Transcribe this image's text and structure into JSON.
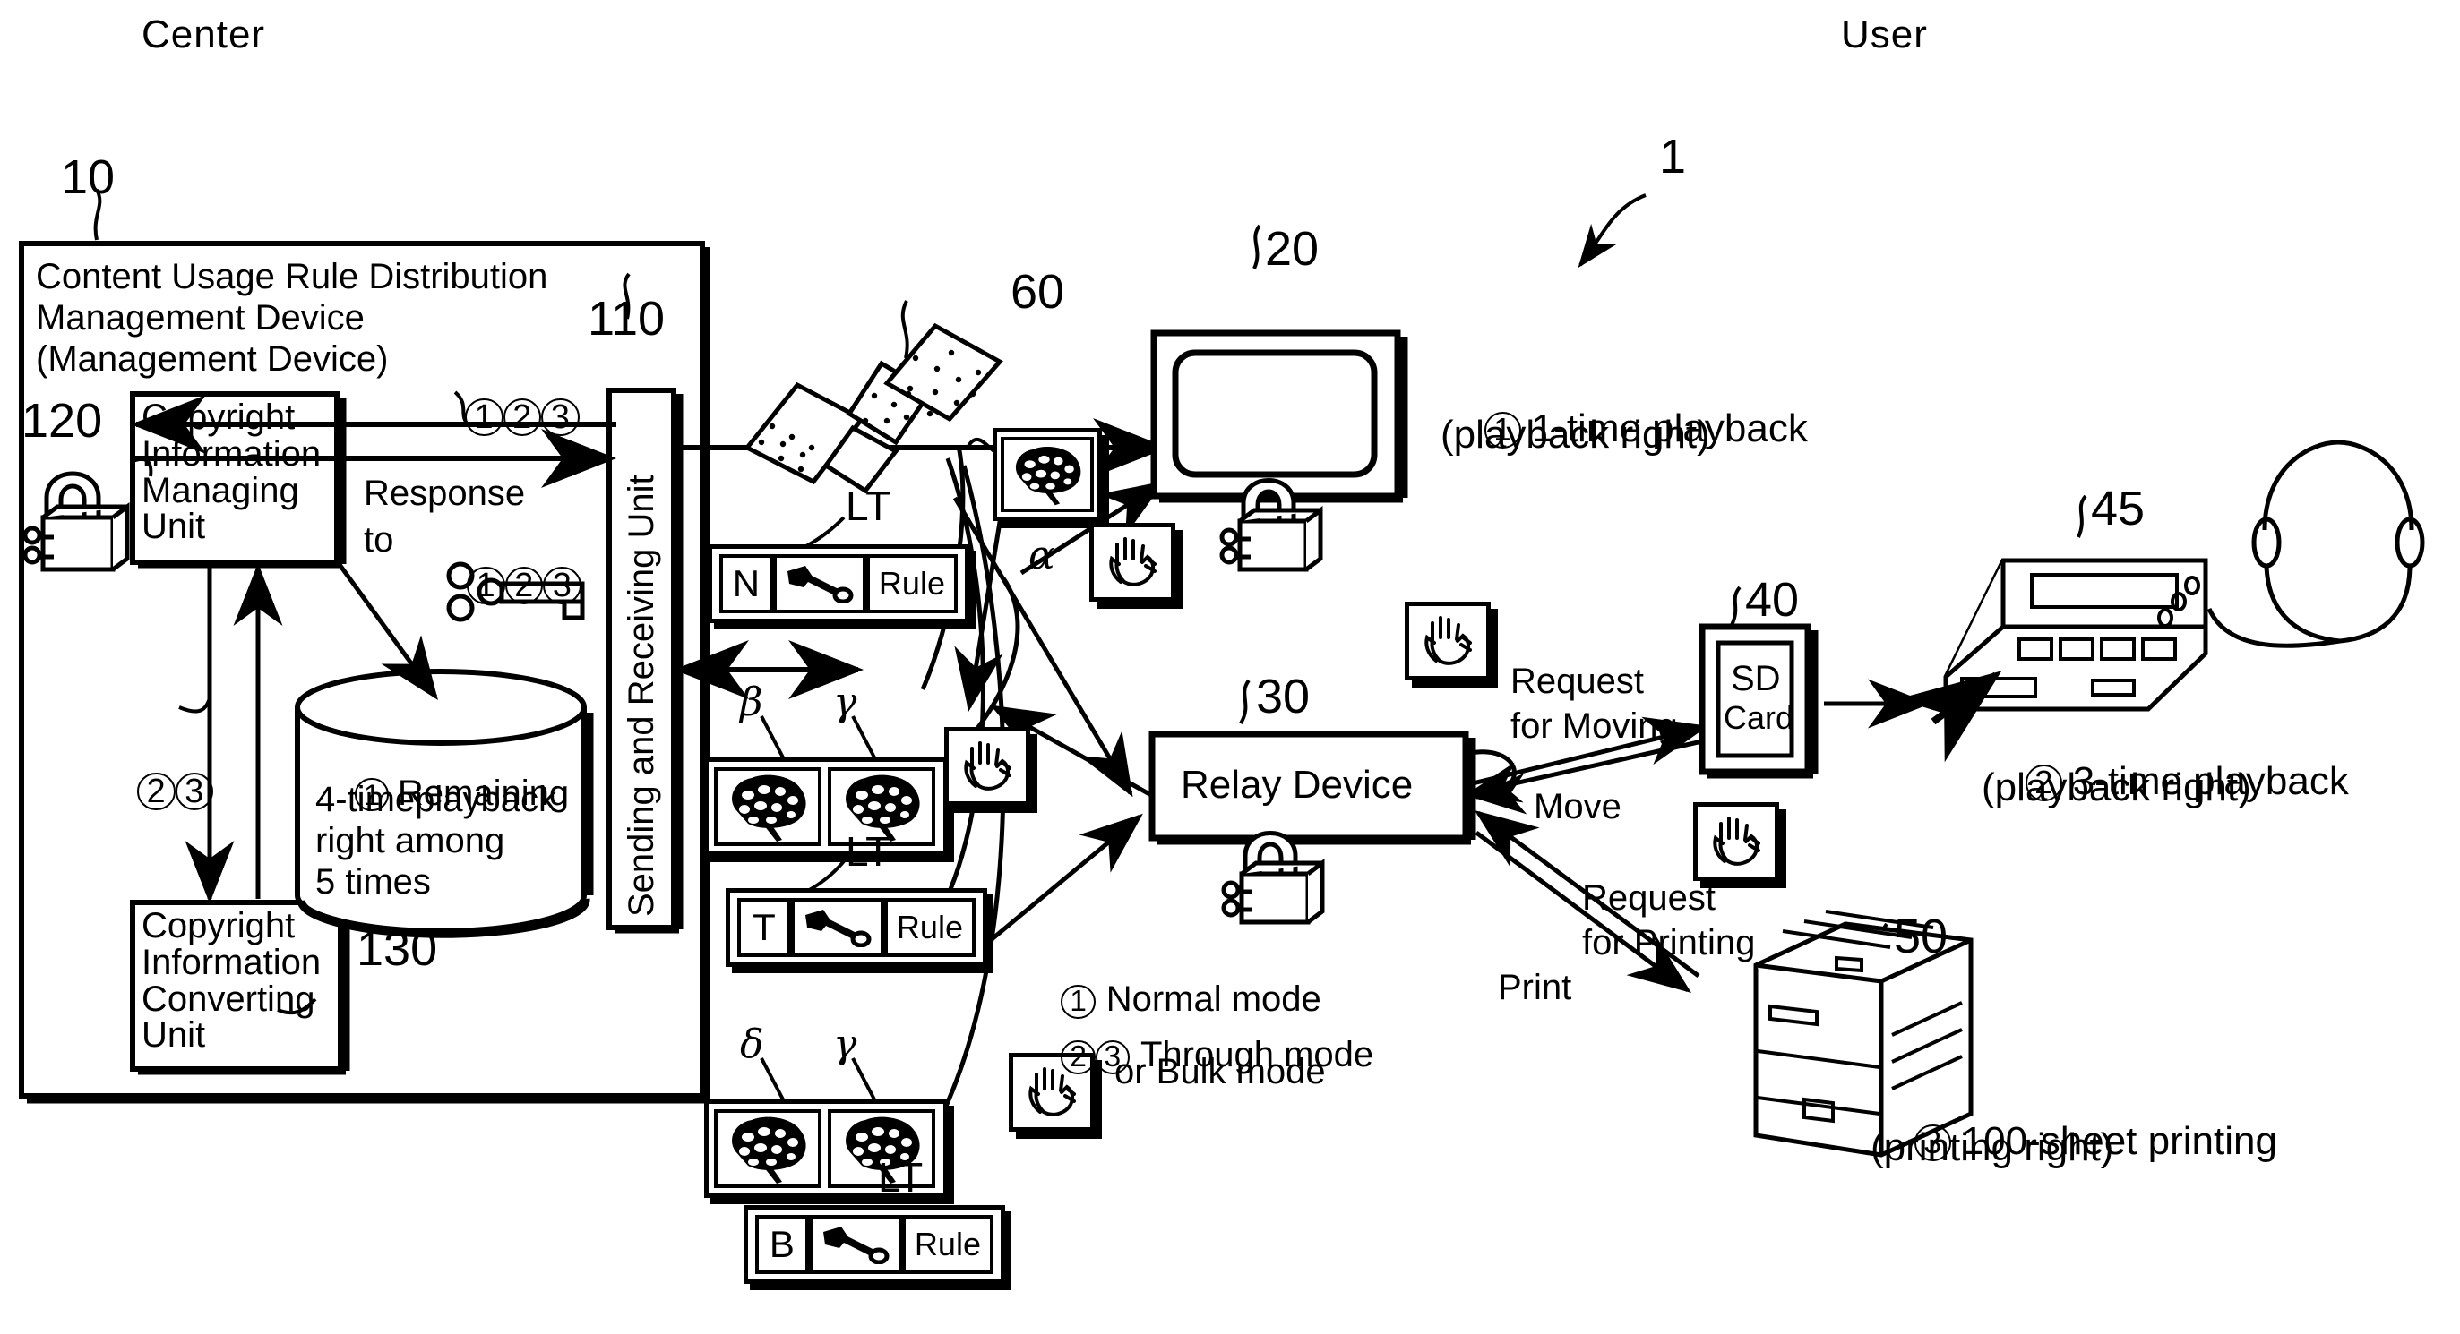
{
  "figure": {
    "system_ref": "1",
    "side_labels": {
      "left": "Center",
      "right": "User"
    }
  },
  "center": {
    "outer_ref": "10",
    "title_line1": "Content Usage Rule Distribution",
    "title_line2": "Management Device",
    "title_line3": "(Management Device)",
    "sending_unit": {
      "ref": "110",
      "label": "Sending and Receiving Unit"
    },
    "managing_unit": {
      "ref": "120",
      "label": "Copyright\nInformation\nManaging\nUnit"
    },
    "converting_unit": {
      "ref": "130",
      "label": "Copyright\nInformation\nConverting\nUnit"
    },
    "database": {
      "marker": "1",
      "line1": "Remaining",
      "line2": "4-timeplayback",
      "line3": "right among",
      "line4": "5 times"
    },
    "request_markers": [
      "1",
      "2",
      "3"
    ],
    "response_label_line1": "Response",
    "response_label_line2": "to",
    "response_markers": [
      "1",
      "2",
      "3"
    ],
    "downstream_markers": [
      "2",
      "3"
    ],
    "lock_icon": "padlock-icon",
    "key_icon": "key-icon"
  },
  "network": {
    "ref": "60",
    "icon": "satellite-icon"
  },
  "license_tickets": [
    {
      "lt_label": "LT",
      "mode_letter": "N",
      "key_icon": "key-icon",
      "rule_label": "Rule"
    },
    {
      "lt_label": "LT",
      "mode_letter": "T",
      "key_icon": "key-icon",
      "rule_label": "Rule"
    },
    {
      "lt_label": "LT",
      "mode_letter": "B",
      "key_icon": "key-icon",
      "rule_label": "Rule"
    }
  ],
  "content_pairs": [
    {
      "left_greek": "β",
      "right_greek": "γ",
      "icon": "brain-icon"
    },
    {
      "left_greek": "δ",
      "right_greek": "γ",
      "icon": "brain-icon"
    }
  ],
  "alpha_content": {
    "greek": "α",
    "icon": "brain-icon"
  },
  "display": {
    "ref": "20",
    "icon": "tv-display-icon"
  },
  "relay": {
    "ref": "30",
    "label": "Relay Device",
    "lock_icon": "padlock-icon",
    "modes": [
      {
        "markers": [
          "1"
        ],
        "label": "Normal mode"
      },
      {
        "markers": [
          "2",
          "3"
        ],
        "label": "Through mode"
      },
      {
        "markers": [],
        "label": "or Bulk mode"
      }
    ]
  },
  "sd_card": {
    "ref": "40",
    "line1": "SD",
    "line2": "Card"
  },
  "portable_player": {
    "ref": "45",
    "icon": "portable-player-icon",
    "headphones_icon": "headphones-icon"
  },
  "printer": {
    "ref": "50",
    "icon": "printer-icon"
  },
  "flow_labels": {
    "request_for_moving_line1": "Request",
    "request_for_moving_line2": "for Moving",
    "move": "Move",
    "request_for_printing_line1": "Request",
    "request_for_printing_line2": "for Printing",
    "print": "Print"
  },
  "user_rights": [
    {
      "marker": "1",
      "line1": "1-time playback",
      "line2": "(playback right)"
    },
    {
      "marker": "2",
      "line1": "3-time playback",
      "line2": "(playback right)"
    },
    {
      "marker": "3",
      "line1": "100-sheet printing",
      "line2": "(printing right)"
    }
  ]
}
